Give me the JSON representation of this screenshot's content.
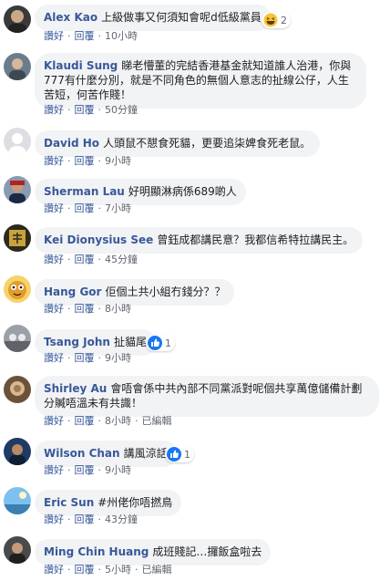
{
  "labels": {
    "like": "讚好",
    "reply": "回覆",
    "sep": "·"
  },
  "comments": [
    {
      "author": "Alex Kao",
      "text": "上級做事又何須知會呢d低級黨員",
      "time": "10小時",
      "reaction": "haha",
      "reaction_count": "2",
      "edited": ""
    },
    {
      "author": "Klaudi Sung",
      "text": "睇老懵董的完結香港基金就知道誰人治港，你與777有什麼分別，就是不同角色的無個人意志的扯線公仔，人生苦短，何苦作賤！",
      "time": "50分鐘",
      "reaction": "",
      "reaction_count": "",
      "edited": ""
    },
    {
      "author": "David Ho",
      "text": "人頭鼠不憇食死貓，更要追柒婢食死老鼠。",
      "time": "9小時",
      "reaction": "",
      "reaction_count": "",
      "edited": ""
    },
    {
      "author": "Sherman Lau",
      "text": "好明顯淋病係689啲人",
      "time": "7小時",
      "reaction": "",
      "reaction_count": "",
      "edited": ""
    },
    {
      "author": "Kei Dionysius See",
      "text": "曾鈺成都講民意？我都信希特拉講民主。",
      "time": "45分鐘",
      "reaction": "",
      "reaction_count": "",
      "edited": ""
    },
    {
      "author": "Hang Gor",
      "text": "佢個土共小組冇錢分？？",
      "time": "8小時",
      "reaction": "",
      "reaction_count": "",
      "edited": ""
    },
    {
      "author": "Tsang John",
      "text": "扯貓尾",
      "time": "9小時",
      "reaction": "like",
      "reaction_count": "1",
      "edited": ""
    },
    {
      "author": "Shirley Au",
      "text": "會唔會係中共內部不同黨派對呢個共享萬億儲備計劃分贓唔溫未有共識！",
      "time": "8小時",
      "reaction": "",
      "reaction_count": "",
      "edited": "已編輯"
    },
    {
      "author": "Wilson Chan",
      "text": "講風涼話",
      "time": "9小時",
      "reaction": "like",
      "reaction_count": "1",
      "edited": ""
    },
    {
      "author": "Eric Sun",
      "text": "#州佬你唔撚鳥",
      "time": "43分鐘",
      "reaction": "",
      "reaction_count": "",
      "edited": ""
    },
    {
      "author": "Ming Chin Huang",
      "text": "成班賤記…攞飯盒啦去",
      "time": "5小時",
      "reaction": "",
      "reaction_count": "",
      "edited": "已編輯"
    }
  ],
  "colors": {
    "author": "#385898",
    "bubble": "#f2f3f5",
    "meta": "#606770",
    "like_blue": "#1877f2",
    "haha_yellow": "#f7c33b"
  }
}
